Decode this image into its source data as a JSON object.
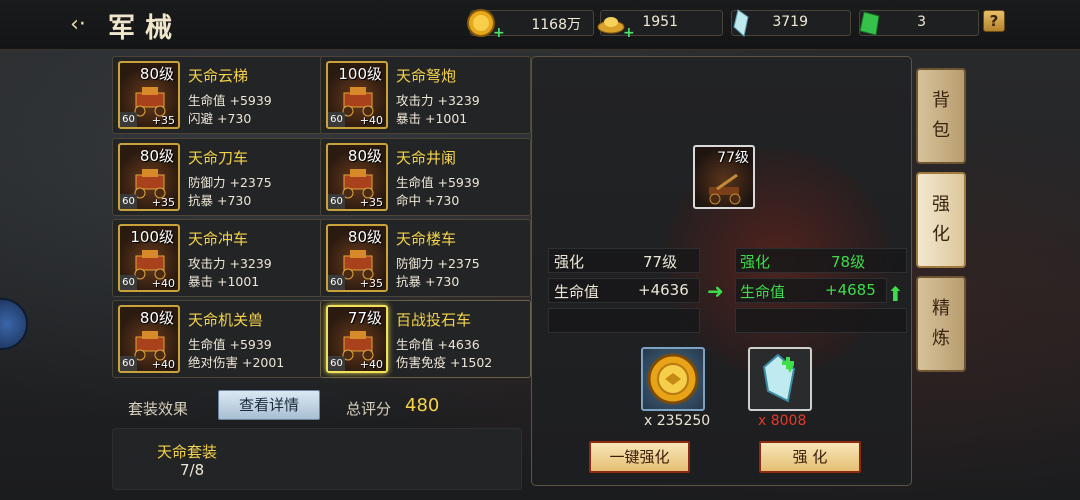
{
  "header": {
    "title": "军械"
  },
  "resources": [
    {
      "name": "gold",
      "icon": "gold-coin-icon",
      "value": "1168万",
      "has_plus": true
    },
    {
      "name": "ingot",
      "icon": "gold-ingot-icon",
      "value": "1951",
      "has_plus": true
    },
    {
      "name": "crystal",
      "icon": "crystal-icon",
      "value": "3719",
      "has_plus": false
    },
    {
      "name": "jade",
      "icon": "green-jade-icon",
      "value": "3",
      "has_plus": false
    }
  ],
  "help": "?",
  "items": [
    {
      "level": "80级",
      "star": "60",
      "plus": "+35",
      "name": "天命云梯",
      "stat1": "生命值 +5939",
      "stat2": "闪避 +730"
    },
    {
      "level": "100级",
      "star": "60",
      "plus": "+40",
      "name": "天命弩炮",
      "stat1": "攻击力 +3239",
      "stat2": "暴击 +1001"
    },
    {
      "level": "80级",
      "star": "60",
      "plus": "+35",
      "name": "天命刀车",
      "stat1": "防御力 +2375",
      "stat2": "抗暴 +730"
    },
    {
      "level": "80级",
      "star": "60",
      "plus": "+35",
      "name": "天命井阑",
      "stat1": "生命值 +5939",
      "stat2": "命中 +730"
    },
    {
      "level": "100级",
      "star": "60",
      "plus": "+40",
      "name": "天命冲车",
      "stat1": "攻击力 +3239",
      "stat2": "暴击 +1001"
    },
    {
      "level": "80级",
      "star": "60",
      "plus": "+35",
      "name": "天命楼车",
      "stat1": "防御力 +2375",
      "stat2": "抗暴 +730"
    },
    {
      "level": "80级",
      "star": "60",
      "plus": "+40",
      "name": "天命机关兽",
      "stat1": "生命值 +5939",
      "stat2": "绝对伤害 +2001"
    },
    {
      "level": "77级",
      "star": "60",
      "plus": "+40",
      "name": "百战投石车",
      "stat1": "生命值 +4636",
      "stat2": "伤害免疫 +1502",
      "selected": true
    }
  ],
  "set": {
    "label": "套装效果",
    "detail_button": "查看详情",
    "score_label": "总评分",
    "score": "480",
    "name": "天命套装",
    "count": "7/8"
  },
  "detail": {
    "level": "77级",
    "current": {
      "label1": "强化",
      "value1": "77级",
      "label2": "生命值",
      "value2": "+4636"
    },
    "next": {
      "label1": "强化",
      "value1": "78级",
      "label2": "生命值",
      "value2": "+4685"
    },
    "cost_gold": "x 235250",
    "cost_crystal": "x 8008",
    "auto_button": "一键强化",
    "enhance_button": "强  化"
  },
  "tabs": [
    {
      "c1": "背",
      "c2": "包",
      "active": false
    },
    {
      "c1": "强",
      "c2": "化",
      "active": true
    },
    {
      "c1": "精",
      "c2": "炼",
      "active": false
    }
  ],
  "colors": {
    "accent_yellow": "#f4d34a",
    "upgrade_green": "#3cdc4a",
    "cost_red": "#e23a2a"
  }
}
